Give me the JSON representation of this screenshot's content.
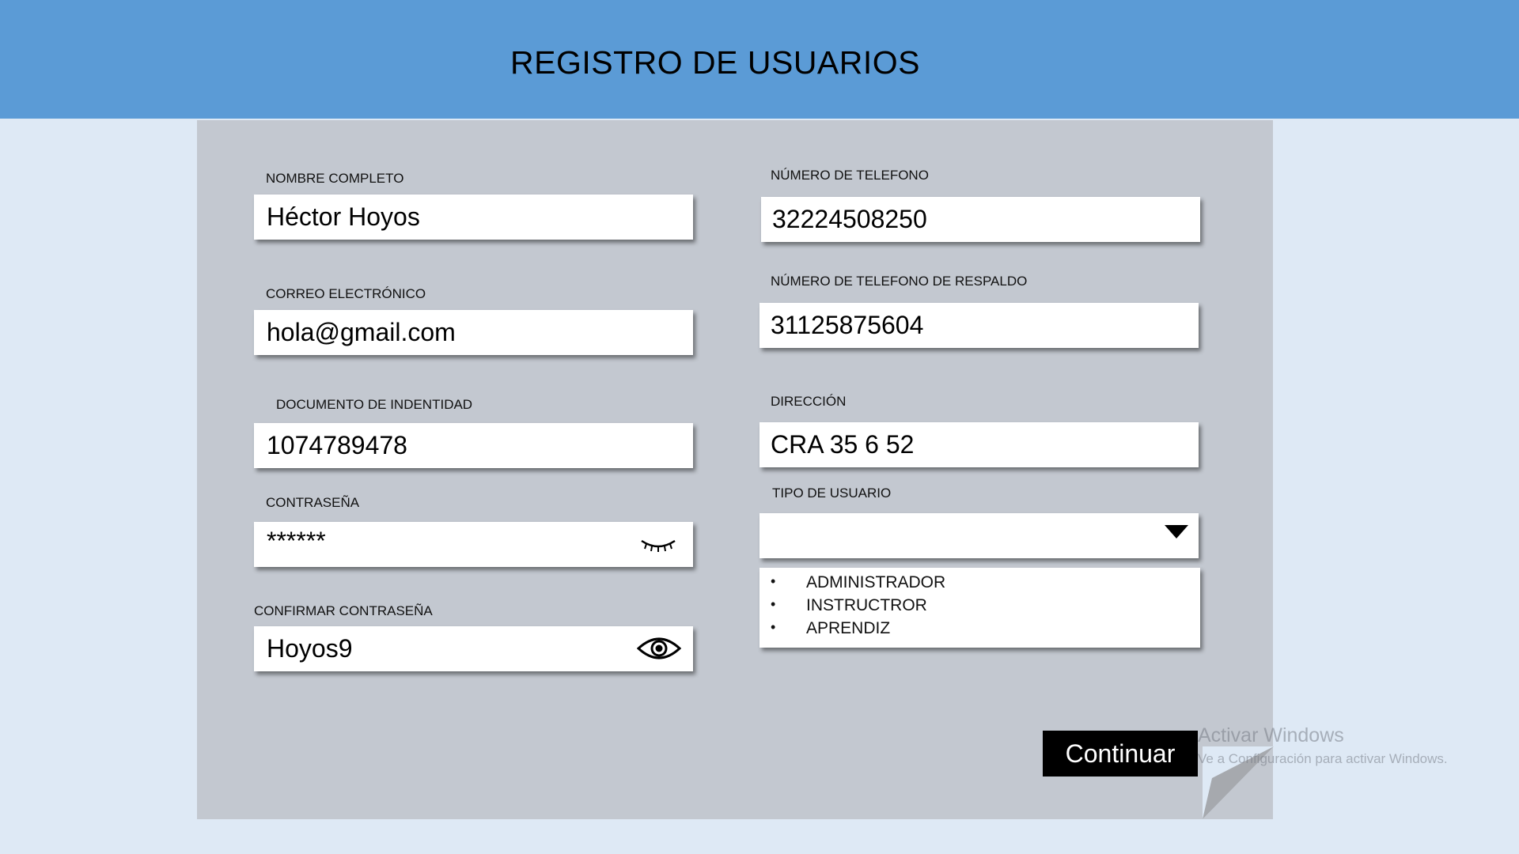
{
  "header": {
    "title": "REGISTRO DE USUARIOS"
  },
  "form": {
    "nombre": {
      "label": "NOMBRE COMPLETO",
      "value": "Héctor  Hoyos"
    },
    "correo": {
      "label": "CORREO ELECTRÓNICO",
      "value": "hola@gmail.com"
    },
    "documento": {
      "label": "DOCUMENTO DE INDENTIDAD",
      "value": "1074789478"
    },
    "contrasena": {
      "label": "CONTRASEÑA",
      "value": "******"
    },
    "confirmar": {
      "label": "CONFIRMAR CONTRASEÑA",
      "value": "Hoyos9"
    },
    "telefono": {
      "label": "NÚMERO DE TELEFONO",
      "value": "32224508250"
    },
    "telefono_respaldo": {
      "label": "NÚMERO DE TELEFONO DE RESPALDO",
      "value": "31125875604"
    },
    "direccion": {
      "label": "DIRECCIÓN",
      "value": "CRA 35 6 52"
    },
    "tipo_usuario": {
      "label": "TIPO DE USUARIO",
      "value": "",
      "options": [
        "ADMINISTRADOR",
        "INSTRUCTROR",
        "APRENDIZ"
      ],
      "bullet": "•"
    }
  },
  "actions": {
    "continue_label": "Continuar"
  },
  "watermark": {
    "title": "Activar Windows",
    "subtitle": "Ve a Configuración para activar Windows."
  },
  "icons": {
    "password_hidden": "eye-closed-icon",
    "password_visible": "eye-icon",
    "dropdown": "caret-down-icon"
  },
  "colors": {
    "header": "#5b9bd6",
    "background": "#dee9f5",
    "card": "#c3c8d0",
    "button": "#000000"
  }
}
